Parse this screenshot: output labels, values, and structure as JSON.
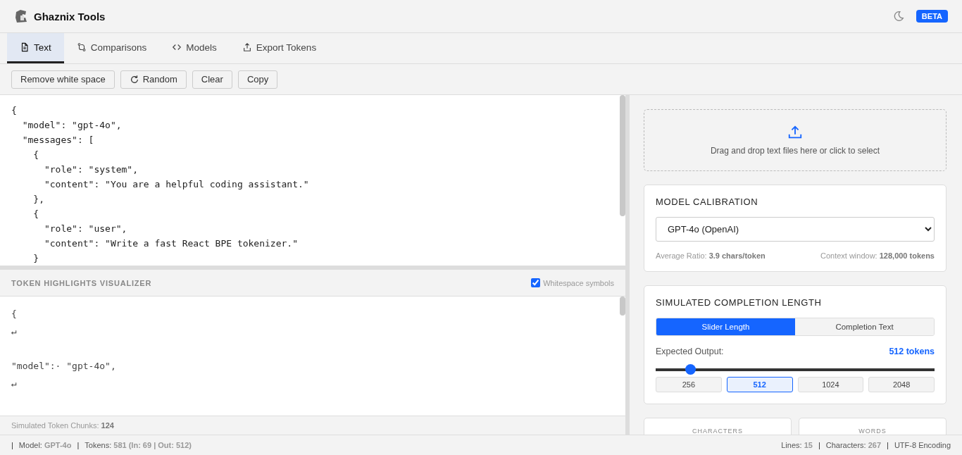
{
  "app": {
    "title": "Ghaznix Tools",
    "badge": "BETA"
  },
  "tabs": [
    {
      "label": "Text",
      "selected": true
    },
    {
      "label": "Comparisons",
      "selected": false
    },
    {
      "label": "Models",
      "selected": false
    },
    {
      "label": "Export Tokens",
      "selected": false
    }
  ],
  "toolbar": [
    {
      "label": "Remove white space"
    },
    {
      "label": "Random"
    },
    {
      "label": "Clear"
    },
    {
      "label": "Copy"
    }
  ],
  "editor": {
    "lines": [
      "{",
      "  \"model\": \"gpt-4o\",",
      "  \"messages\": [",
      "    {",
      "      \"role\": \"system\",",
      "      \"content\": \"You are a helpful coding assistant.\"",
      "    },",
      "    {",
      "      \"role\": \"user\",",
      "      \"content\": \"Write a fast React BPE tokenizer.\"",
      "    }"
    ]
  },
  "visualizer": {
    "title": "TOKEN HIGHLIGHTS VISUALIZER",
    "whitespace_option": {
      "label": "Whitespace symbols",
      "checked": true
    },
    "tokens": [
      {
        "text": "{",
        "kind": "token"
      },
      {
        "text": "↵",
        "kind": "newline"
      },
      {
        "text": "\"model\":· \"gpt-4o\",",
        "kind": "token"
      },
      {
        "text": "↵",
        "kind": "newline"
      }
    ],
    "footer_label": "Simulated Token Chunks:",
    "footer_value": "124"
  },
  "upload": {
    "text": "Drag and drop text files here or click to select"
  },
  "calibration": {
    "title": "MODEL CALIBRATION",
    "model": "GPT-4o (OpenAI)",
    "ratio_label": "Average Ratio:",
    "ratio_value": "3.9 chars/token",
    "context_label": "Context window:",
    "context_value": "128,000 tokens"
  },
  "completion": {
    "title": "SIMULATED COMPLETION LENGTH",
    "modes": [
      {
        "label": "Slider Length",
        "selected": true
      },
      {
        "label": "Completion Text",
        "selected": false
      }
    ],
    "output_label": "Expected Output:",
    "output_value": "512 tokens",
    "level": 0.124,
    "presets": [
      {
        "label": "256",
        "selected": false
      },
      {
        "label": "512",
        "selected": true
      },
      {
        "label": "1024",
        "selected": false
      },
      {
        "label": "2048",
        "selected": false
      }
    ]
  },
  "stats": [
    {
      "label": "CHARACTERS"
    },
    {
      "label": "WORDS"
    }
  ],
  "status_bar": {
    "left": [
      {
        "label": "Model:",
        "value": "GPT-4o"
      },
      {
        "label": "Tokens:",
        "value": "581 (In: 69 | Out: 512)"
      }
    ],
    "right": [
      {
        "label": "Lines:",
        "value": "15"
      },
      {
        "label": "Characters:",
        "value": "267"
      },
      {
        "label": "UTF-8 Encoding"
      }
    ],
    "separator": "|"
  }
}
